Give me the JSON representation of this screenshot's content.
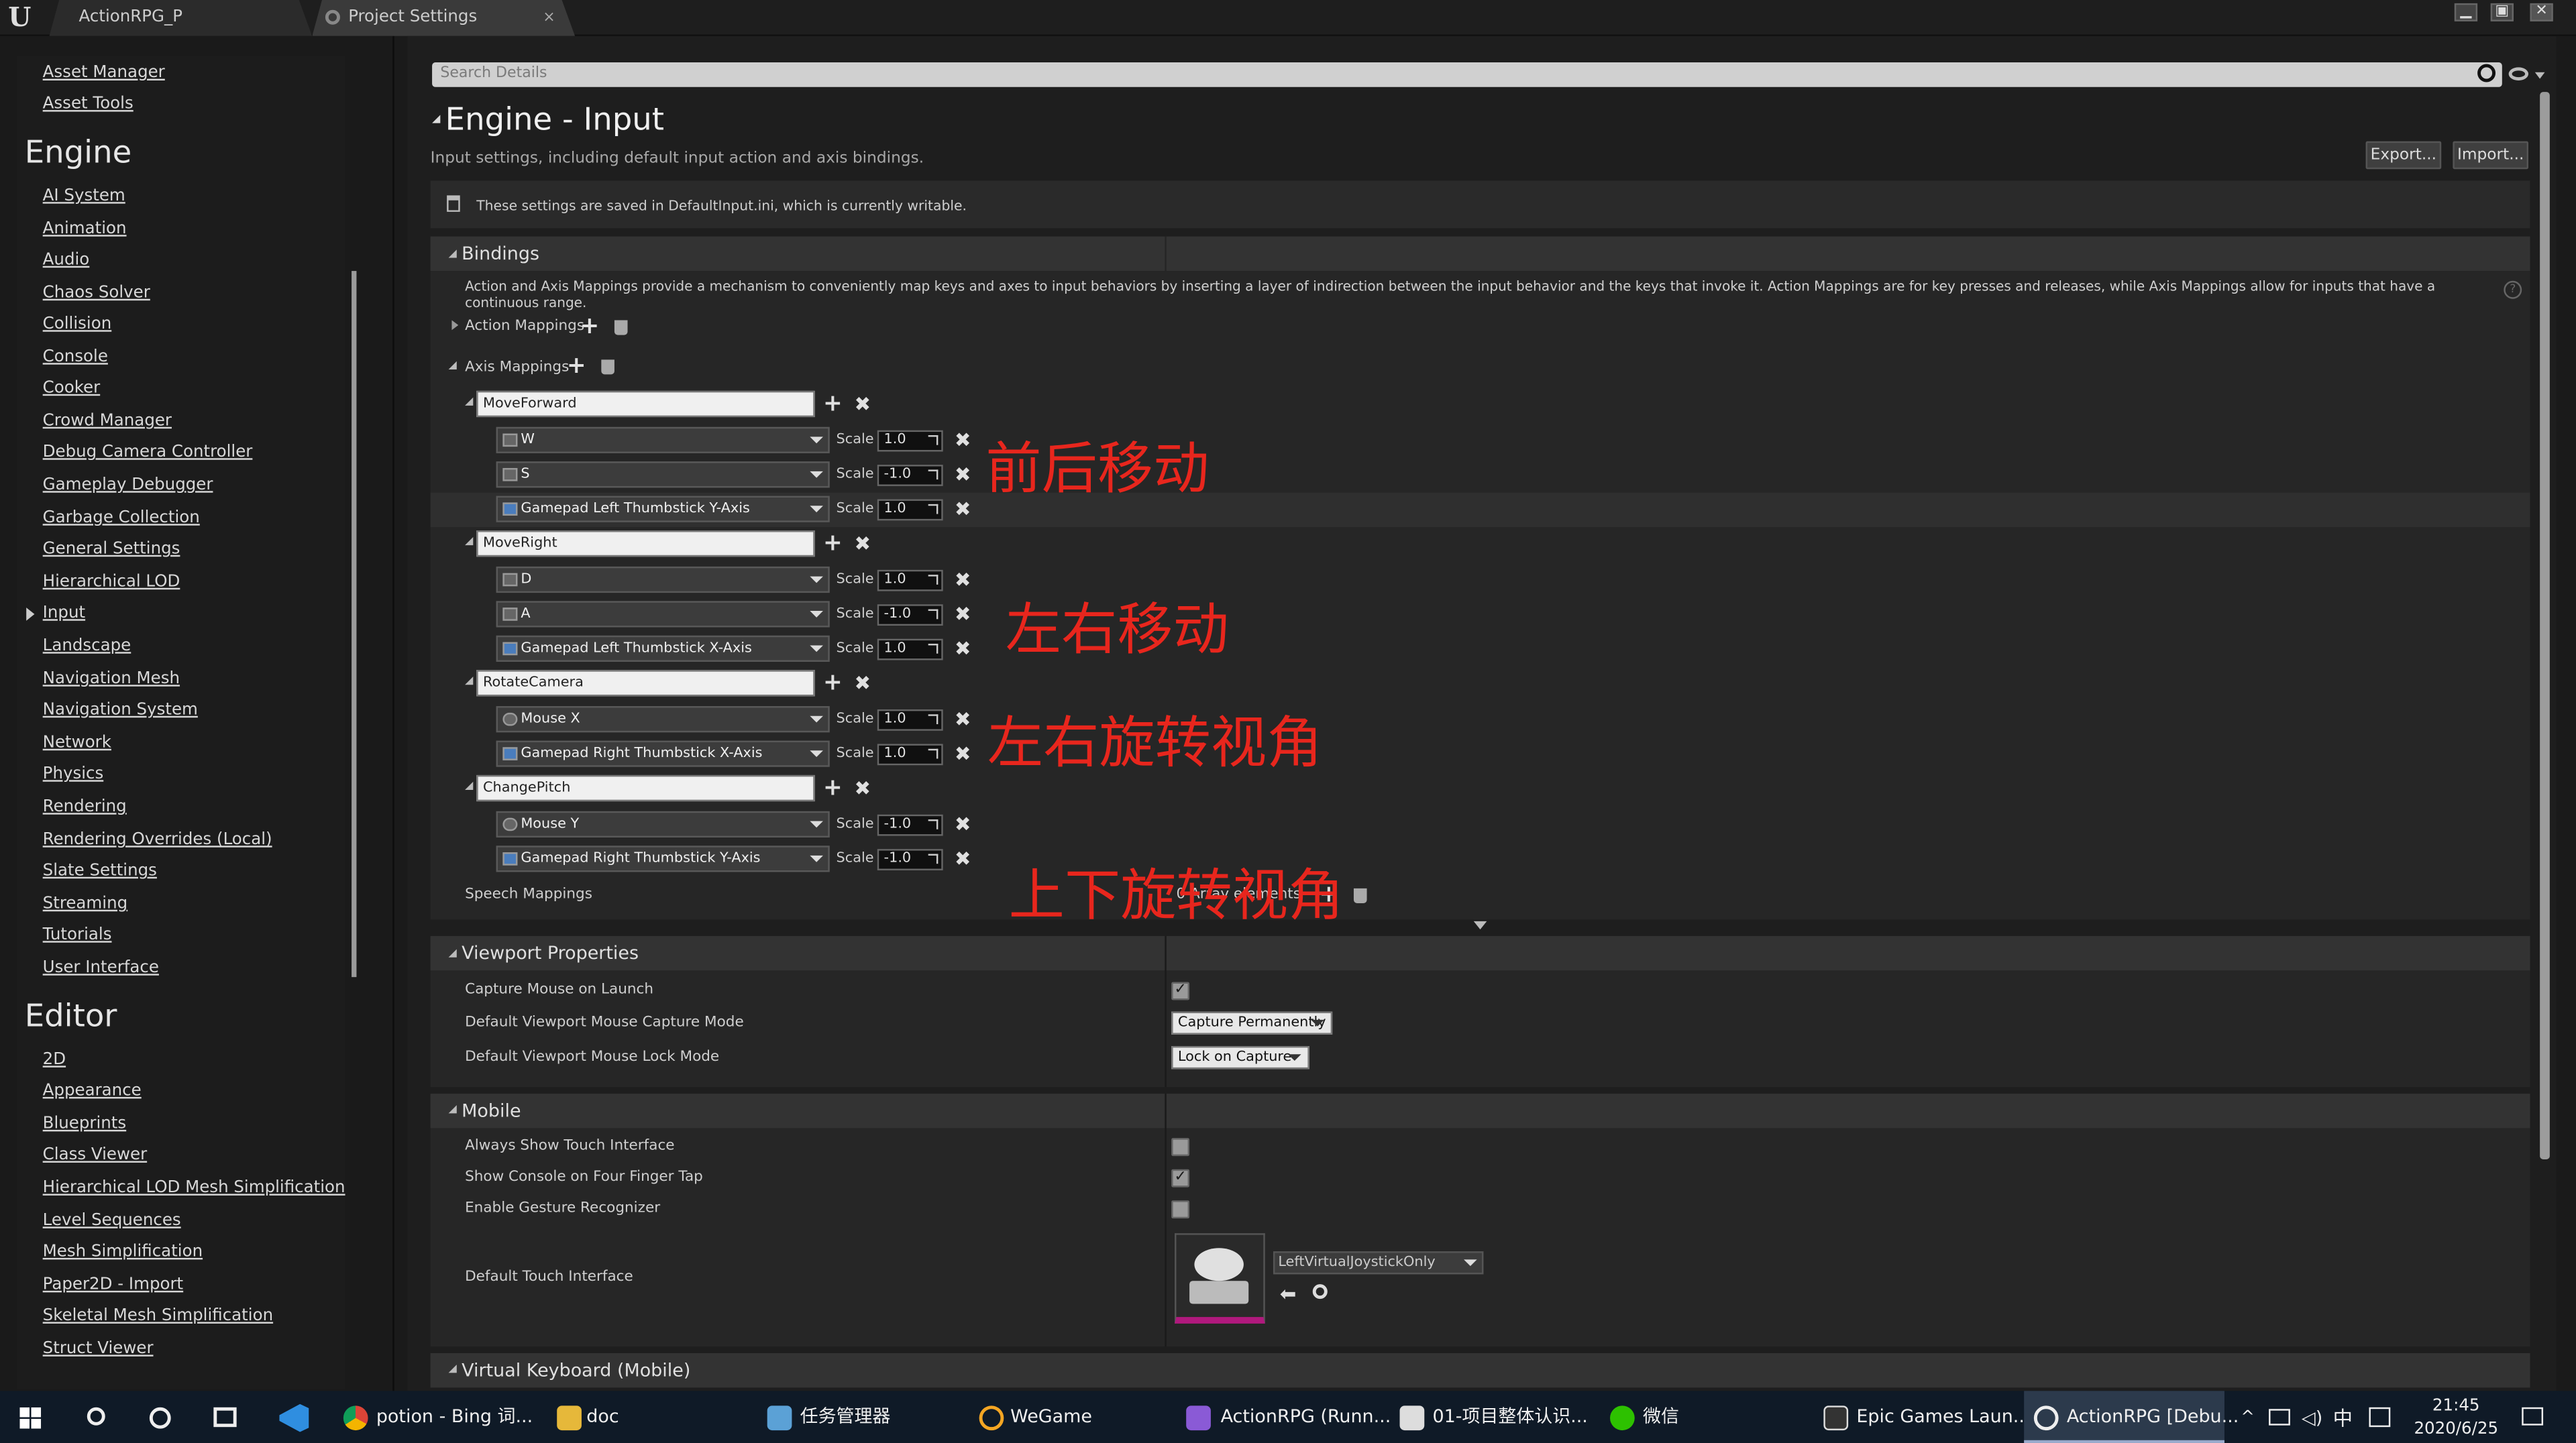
{
  "window": {
    "tabs": [
      {
        "label": "ActionRPG_P"
      },
      {
        "label": "Project Settings"
      }
    ],
    "controls": {
      "minimize": "▁",
      "maximize": "▣",
      "close": "✕"
    }
  },
  "sidebar": {
    "top_items": [
      "Asset Manager",
      "Asset Tools"
    ],
    "engine_heading": "Engine",
    "engine_items": [
      "AI System",
      "Animation",
      "Audio",
      "Chaos Solver",
      "Collision",
      "Console",
      "Cooker",
      "Crowd Manager",
      "Debug Camera Controller",
      "Gameplay Debugger",
      "Garbage Collection",
      "General Settings",
      "Hierarchical LOD",
      "Input",
      "Landscape",
      "Navigation Mesh",
      "Navigation System",
      "Network",
      "Physics",
      "Rendering",
      "Rendering Overrides (Local)",
      "Slate Settings",
      "Streaming",
      "Tutorials",
      "User Interface"
    ],
    "editor_heading": "Editor",
    "editor_items": [
      "2D",
      "Appearance",
      "Blueprints",
      "Class Viewer",
      "Hierarchical LOD Mesh Simplification",
      "Level Sequences",
      "Mesh Simplification",
      "Paper2D - Import",
      "Skeletal Mesh Simplification",
      "Struct Viewer"
    ]
  },
  "search": {
    "placeholder": "Search Details"
  },
  "header": {
    "title": "Engine - Input",
    "subtitle": "Input settings, including default input action and axis bindings.",
    "export": "Export...",
    "import": "Import...",
    "notice": "These settings are saved in DefaultInput.ini, which is currently writable."
  },
  "bindings": {
    "title": "Bindings",
    "description": "Action and Axis Mappings provide a mechanism to conveniently map keys and axes to input behaviors by inserting a layer of indirection between the input behavior and the keys that invoke it. Action Mappings are for key presses and releases, while Axis Mappings allow for inputs that have a continuous range.",
    "action_mappings": "Action Mappings",
    "axis_mappings": "Axis Mappings",
    "scale_label": "Scale",
    "groups": [
      {
        "name": "MoveForward",
        "rows": [
          {
            "key": "W",
            "scale": "1.0"
          },
          {
            "key": "S",
            "scale": "-1.0"
          },
          {
            "key": "Gamepad Left Thumbstick Y-Axis",
            "scale": "1.0"
          }
        ]
      },
      {
        "name": "MoveRight",
        "rows": [
          {
            "key": "D",
            "scale": "1.0"
          },
          {
            "key": "A",
            "scale": "-1.0"
          },
          {
            "key": "Gamepad Left Thumbstick X-Axis",
            "scale": "1.0"
          }
        ]
      },
      {
        "name": "RotateCamera",
        "rows": [
          {
            "key": "Mouse X",
            "scale": "1.0"
          },
          {
            "key": "Gamepad Right Thumbstick X-Axis",
            "scale": "1.0"
          }
        ]
      },
      {
        "name": "ChangePitch",
        "rows": [
          {
            "key": "Mouse Y",
            "scale": "-1.0"
          },
          {
            "key": "Gamepad Right Thumbstick Y-Axis",
            "scale": "-1.0"
          }
        ]
      }
    ],
    "speech_mappings": "Speech Mappings",
    "speech_value": "0 Array elements"
  },
  "annotations": [
    "前后移动",
    "左右移动",
    "左右旋转视角",
    "上下旋转视角"
  ],
  "viewport": {
    "title": "Viewport Properties",
    "rows": [
      {
        "label": "Capture Mouse on Launch",
        "checked": true
      },
      {
        "label": "Default Viewport Mouse Capture Mode",
        "value": "Capture Permanently"
      },
      {
        "label": "Default Viewport Mouse Lock Mode",
        "value": "Lock on Capture"
      }
    ]
  },
  "mobile": {
    "title": "Mobile",
    "rows": [
      {
        "label": "Always Show Touch Interface",
        "checked": false
      },
      {
        "label": "Show Console on Four Finger Tap",
        "checked": true
      },
      {
        "label": "Enable Gesture Recognizer",
        "checked": false
      }
    ],
    "touch_label": "Default Touch Interface",
    "touch_value": "LeftVirtualJoystickOnly"
  },
  "virtual_keyboard": {
    "title": "Virtual Keyboard (Mobile)"
  },
  "taskbar": {
    "items": [
      "potion - Bing 词...",
      "doc",
      "任务管理器",
      "WeGame",
      "ActionRPG (Runn...",
      "01-项目整体认识...",
      "微信",
      "Epic Games Laun...",
      "ActionRPG [Debu..."
    ],
    "ime": "中",
    "time": "21:45",
    "date": "2020/6/25"
  },
  "colors": {
    "annotation": "#e8261d",
    "taskbar": "#0f1a27",
    "panel": "#262626",
    "category": "#333333"
  }
}
